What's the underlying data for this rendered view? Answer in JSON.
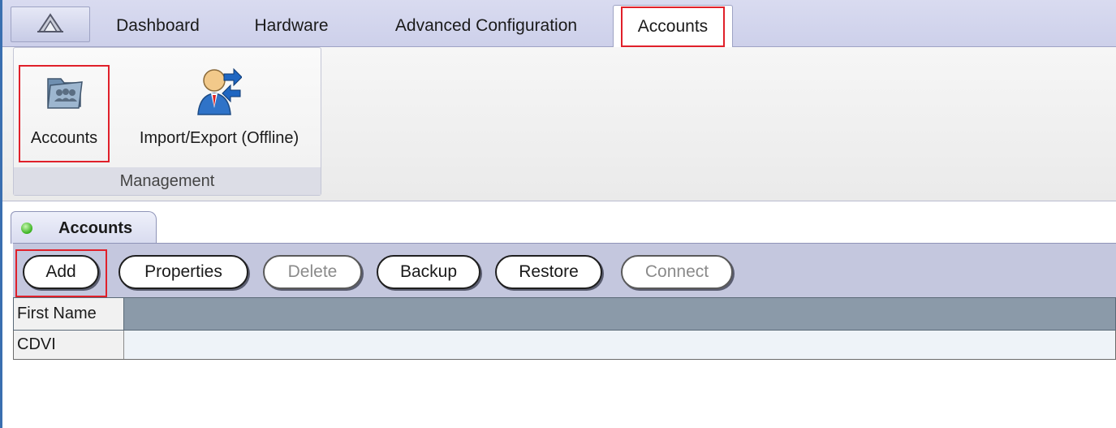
{
  "ribbon": {
    "tabs": [
      {
        "label": "Dashboard"
      },
      {
        "label": "Hardware"
      },
      {
        "label": "Advanced Configuration"
      },
      {
        "label": "Accounts",
        "active": true
      }
    ],
    "groups": [
      {
        "caption": "Management",
        "buttons": [
          {
            "label": "Accounts",
            "icon": "accounts-folder-icon"
          },
          {
            "label": "Import/Export (Offline)",
            "icon": "import-export-user-icon"
          }
        ]
      }
    ]
  },
  "document": {
    "tab_label": "Accounts",
    "status_color": "#38b21e",
    "toolbar": {
      "buttons": [
        {
          "label": "Add",
          "enabled": true
        },
        {
          "label": "Properties",
          "enabled": true
        },
        {
          "label": "Delete",
          "enabled": false
        },
        {
          "label": "Backup",
          "enabled": true
        },
        {
          "label": "Restore",
          "enabled": true
        },
        {
          "label": "Connect",
          "enabled": false
        }
      ]
    },
    "grid": {
      "columns": [
        "First Name"
      ],
      "rows": [
        [
          "CDVI"
        ]
      ]
    }
  },
  "colors": {
    "highlight": "#e0202a",
    "tab_row": "#cdd0ea",
    "grid_header": "#8b9aa9"
  }
}
